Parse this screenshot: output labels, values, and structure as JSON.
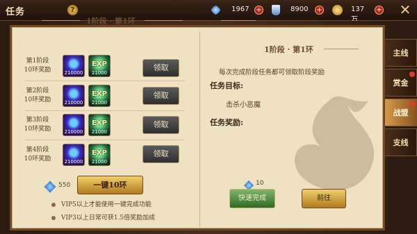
{
  "header": {
    "title": "任务",
    "help_icon": "?",
    "resources": [
      {
        "name": "diamond",
        "icon": "diamond-icon",
        "value": "1967"
      },
      {
        "name": "bottle",
        "icon": "bottle-icon",
        "value": "8900"
      },
      {
        "name": "gold",
        "icon": "coin-icon",
        "value": "137万"
      }
    ],
    "plus_label": "+",
    "close_label": "✕"
  },
  "left": {
    "section_title": "1阶段 · 第1环",
    "rows": [
      {
        "label_line1": "第1阶段",
        "label_line2": "10环奖励",
        "item1_qty": "210000",
        "item2_label": "EXP",
        "item2_qty": "21000",
        "claim_label": "领取"
      },
      {
        "label_line1": "第2阶段",
        "label_line2": "10环奖励",
        "item1_qty": "210000",
        "item2_label": "EXP",
        "item2_qty": "21000",
        "claim_label": "领取"
      },
      {
        "label_line1": "第3阶段",
        "label_line2": "10环奖励",
        "item1_qty": "210000",
        "item2_label": "EXP",
        "item2_qty": "21000",
        "claim_label": "领取"
      },
      {
        "label_line1": "第4阶段",
        "label_line2": "10环奖励",
        "item1_qty": "210000",
        "item2_label": "EXP",
        "item2_qty": "21000",
        "claim_label": "领取"
      }
    ],
    "onekey_cost": "550",
    "onekey_label": "一键10环",
    "vip_notes": [
      "VIP5以上才能使用一键完成功能",
      "VIP3以上日常可获1.5倍奖励加成"
    ]
  },
  "right": {
    "section_title": "1阶段 · 第1环",
    "description": "每次完成阶段任务都可领取阶段奖励",
    "target_label": "任务目标:",
    "target_value": "击杀小恶魔",
    "reward_label": "任务奖励:",
    "cost": "10",
    "quick_label": "快速完成",
    "goto_label": "前往"
  },
  "tabs": [
    {
      "label": "主线",
      "active": false,
      "badge": false
    },
    {
      "label": "赏金",
      "active": false,
      "badge": true
    },
    {
      "label": "战盟",
      "active": true,
      "badge": true
    },
    {
      "label": "支线",
      "active": false,
      "badge": false
    }
  ],
  "colors": {
    "panel_bg": "#efe2c2",
    "frame": "#6b4a2a",
    "gold_button": "#f2cf69",
    "green_button": "#2f6a24",
    "badge": "#e23a2a"
  }
}
